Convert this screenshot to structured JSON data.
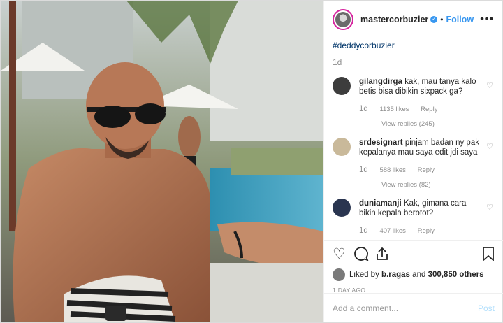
{
  "header": {
    "username": "mastercorbuzier",
    "separator": "•",
    "follow_label": "Follow",
    "more_label": "•••"
  },
  "caption": {
    "hashtag": "#deddycorbuzier",
    "age": "1d"
  },
  "comments": [
    {
      "username": "gilangdirga",
      "text": "kak, mau tanya kalo betis bisa dibikin sixpack ga?",
      "age": "1d",
      "likes": "1135 likes",
      "reply_label": "Reply",
      "view_replies": "View replies (245)",
      "avatar_color": "#3d3d3d"
    },
    {
      "username": "srdesignart",
      "text": "pinjam badan ny pak kepalanya mau saya edit jdi saya",
      "age": "1d",
      "likes": "588 likes",
      "reply_label": "Reply",
      "view_replies": "View replies (82)",
      "avatar_color": "#c9b99a"
    },
    {
      "username": "duniamanji",
      "text": "Kak, gimana cara bikin kepala berotot?",
      "age": "1d",
      "likes": "407 likes",
      "reply_label": "Reply",
      "view_replies": "",
      "avatar_color": "#2a3550"
    }
  ],
  "actions": {
    "liked_by_prefix": "Liked by",
    "liked_by_user": "b.ragas",
    "liked_by_middle": "and",
    "liked_by_count": "300,850 others",
    "date": "1 DAY AGO"
  },
  "add_comment": {
    "placeholder": "Add a comment...",
    "post_label": "Post"
  },
  "icons": [
    "heart-icon",
    "comment-icon",
    "share-icon",
    "bookmark-icon",
    "verified-icon",
    "more-options-icon"
  ],
  "colors": {
    "link": "#3897f0",
    "hashtag": "#003569",
    "muted": "#8e8e8e",
    "post_disabled": "#b2dffc"
  }
}
